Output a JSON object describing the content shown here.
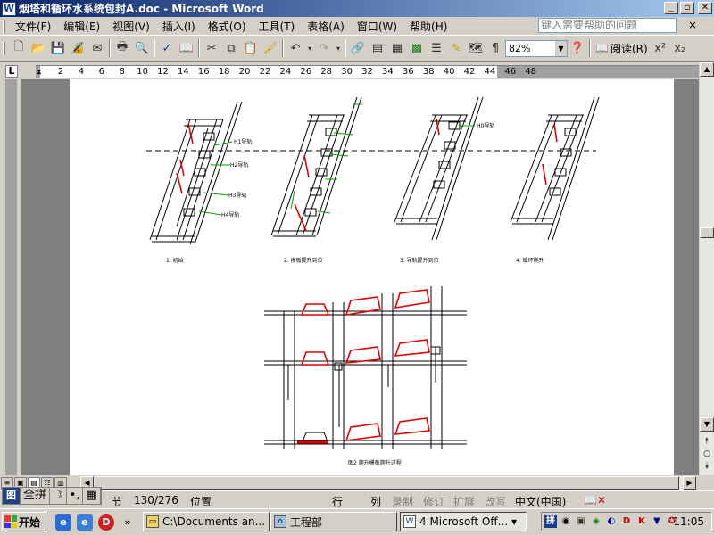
{
  "window": {
    "title": "烟塔和循环水系统包封A.doc - Microsoft Word",
    "icon_text": "W",
    "min_label": "_",
    "max_label": "▫",
    "close_label": "✕"
  },
  "menu": {
    "items": [
      "文件(F)",
      "编辑(E)",
      "视图(V)",
      "插入(I)",
      "格式(O)",
      "工具(T)",
      "表格(A)",
      "窗口(W)",
      "帮助(H)"
    ],
    "help_placeholder": "键入需要帮助的问题",
    "close_label": "×"
  },
  "toolbar": {
    "zoom": "82%",
    "reading_label": "阅读(R)",
    "superscript": "x²",
    "subscript": "x₂"
  },
  "ruler": {
    "tab_selector": "L",
    "ticks": [
      "2",
      "4",
      "6",
      "8",
      "10",
      "12",
      "14",
      "16",
      "18",
      "20",
      "22",
      "24",
      "26",
      "28",
      "30",
      "32",
      "34",
      "36",
      "38",
      "40",
      "42",
      "44",
      "46",
      "48"
    ]
  },
  "document": {
    "stage_labels": [
      "H1导轨",
      "H2导轨",
      "H3导轨",
      "H4导轨",
      "H0导轨"
    ],
    "caption": "图2 爬升模板爬升过程",
    "sub_captions": [
      "1. 初始",
      "2. 模板提升到位",
      "3. 导轨提升到位",
      "4. 循环爬升"
    ]
  },
  "status": {
    "section_label": "节",
    "page_count": "130/276",
    "position_label": "位置",
    "line_label": "行",
    "column_label": "列",
    "record": "录制",
    "revision": "修订",
    "extend": "扩展",
    "overtype": "改写",
    "language": "中文(中国)"
  },
  "ime": {
    "logo": "图",
    "mode": "全拼",
    "moon": "☽",
    "punct": "•,",
    "keyboard": "▦"
  },
  "taskbar": {
    "start_label": "开始",
    "tasks": [
      {
        "label": "C:\\Documents an...",
        "icon": "folder-icon"
      },
      {
        "label": "工程部",
        "icon": "network-icon"
      },
      {
        "label": "4 Microsoft Off...",
        "icon": "word-icon"
      }
    ],
    "clock": "11:05"
  }
}
